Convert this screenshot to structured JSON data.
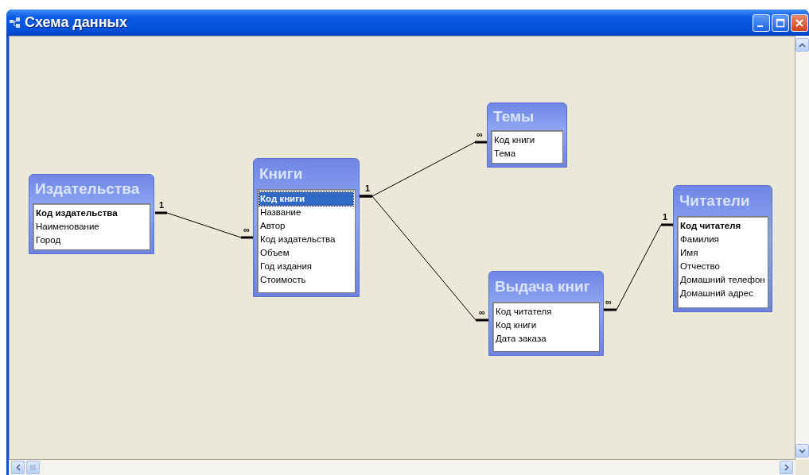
{
  "window": {
    "title": "Схема данных"
  },
  "tables": [
    {
      "name": "Издательства",
      "fields": [
        {
          "name": "Код издательства",
          "key": true,
          "selected": false
        },
        {
          "name": "Наименование",
          "key": false,
          "selected": false
        },
        {
          "name": "Город",
          "key": false,
          "selected": false
        }
      ]
    },
    {
      "name": "Книги",
      "fields": [
        {
          "name": "Код книги",
          "key": true,
          "selected": true
        },
        {
          "name": "Название",
          "key": false,
          "selected": false
        },
        {
          "name": "Автор",
          "key": false,
          "selected": false
        },
        {
          "name": "Код издательства",
          "key": false,
          "selected": false
        },
        {
          "name": "Объем",
          "key": false,
          "selected": false
        },
        {
          "name": "Год издания",
          "key": false,
          "selected": false
        },
        {
          "name": "Стоимость",
          "key": false,
          "selected": false
        }
      ]
    },
    {
      "name": "Темы",
      "fields": [
        {
          "name": "Код книги",
          "key": false,
          "selected": false
        },
        {
          "name": "Тема",
          "key": false,
          "selected": false
        }
      ]
    },
    {
      "name": "Читатели",
      "fields": [
        {
          "name": "Код читателя",
          "key": true,
          "selected": false
        },
        {
          "name": "Фамилия",
          "key": false,
          "selected": false
        },
        {
          "name": "Имя",
          "key": false,
          "selected": false
        },
        {
          "name": "Отчество",
          "key": false,
          "selected": false
        },
        {
          "name": "Домашний телефон",
          "key": false,
          "selected": false
        },
        {
          "name": "Домашний адрес",
          "key": false,
          "selected": false
        }
      ]
    },
    {
      "name": "Выдача книг",
      "fields": [
        {
          "name": "Код читателя",
          "key": false,
          "selected": false
        },
        {
          "name": "Код книги",
          "key": false,
          "selected": false
        },
        {
          "name": "Дата заказа",
          "key": false,
          "selected": false
        }
      ]
    }
  ],
  "relationships": [
    {
      "one_label": "1",
      "many_label": "∞"
    },
    {
      "one_label": "1",
      "many_label": "∞"
    },
    {
      "many_label": "∞"
    },
    {
      "one_label": "1",
      "many_label": "∞"
    }
  ]
}
